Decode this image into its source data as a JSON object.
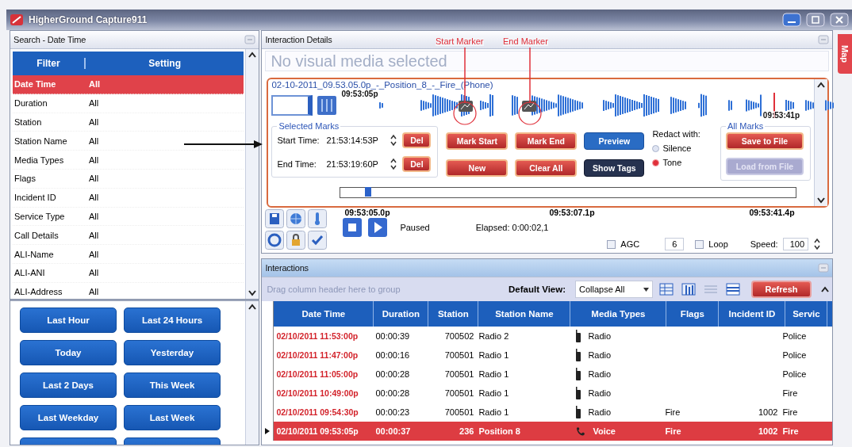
{
  "window": {
    "title": "HigherGround Capture911"
  },
  "search": {
    "title": "Search - Date Time",
    "columns": [
      "Filter",
      "Setting"
    ],
    "filters": [
      {
        "name": "Date Time",
        "setting": "All",
        "selected": true
      },
      {
        "name": "Duration",
        "setting": "All",
        "selected": false
      },
      {
        "name": "Station",
        "setting": "All",
        "selected": false
      },
      {
        "name": "Station Name",
        "setting": "All",
        "selected": false
      },
      {
        "name": "Media Types",
        "setting": "All",
        "selected": false
      },
      {
        "name": "Flags",
        "setting": "All",
        "selected": false
      },
      {
        "name": "Incident ID",
        "setting": "All",
        "selected": false
      },
      {
        "name": "Service Type",
        "setting": "All",
        "selected": false
      },
      {
        "name": "Call Details",
        "setting": "All",
        "selected": false
      },
      {
        "name": "ALI-Name",
        "setting": "All",
        "selected": false
      },
      {
        "name": "ALI-ANI",
        "setting": "All",
        "selected": false
      },
      {
        "name": "ALI-Address",
        "setting": "All",
        "selected": false
      }
    ],
    "quick_buttons": [
      "Last Hour",
      "Last 24 Hours",
      "Today",
      "Yesterday",
      "Last 2 Days",
      "This Week",
      "Last Weekday",
      "Last Week"
    ]
  },
  "annotations": [
    "Start Marker",
    "End Marker"
  ],
  "details": {
    "title": "Interaction Details",
    "visual_placeholder": "No visual media selected",
    "recording_title": "02-10-2011_09.53.05.0p_-_Position_8_-_Fire_(Phone)",
    "wave_start": "09:53:05p",
    "wave_end": "09:53:41p",
    "marks": {
      "title": "Selected Marks",
      "rows": [
        {
          "label": "Start Time:",
          "value": "21:53:14:53P",
          "button": "Del"
        },
        {
          "label": "End Time:",
          "value": "21:53:19:60P",
          "button": "Del"
        }
      ]
    },
    "actions": [
      {
        "label": "Mark Start",
        "kind": "red"
      },
      {
        "label": "Mark End",
        "kind": "red"
      },
      {
        "label": "Preview",
        "kind": "blue"
      },
      {
        "label": "New",
        "kind": "red"
      },
      {
        "label": "Clear All",
        "kind": "red"
      },
      {
        "label": "Show Tags",
        "kind": "navy"
      }
    ],
    "redact": {
      "label": "Redact with:",
      "options": [
        {
          "label": "Silence",
          "selected": false
        },
        {
          "label": "Tone",
          "selected": true
        }
      ]
    },
    "all_marks": {
      "title": "All Marks",
      "buttons": [
        {
          "label": "Save to File",
          "disabled": false
        },
        {
          "label": "Load from File",
          "disabled": true
        }
      ]
    },
    "timeline": {
      "level": 0.06,
      "ticks": [
        "09:53:05.0p",
        "09:53:07.1p",
        "09:53:41.4p"
      ]
    },
    "playback": {
      "status": "Paused",
      "elapsed": "Elapsed: 0:00:02,1",
      "agc": {
        "label": "AGC",
        "checked": false
      },
      "gain": "6",
      "loop": {
        "label": "Loop",
        "checked": false
      },
      "speed_label": "Speed:",
      "speed": "100"
    }
  },
  "map_tab": "Map",
  "interactions": {
    "title": "Interactions",
    "group_hint": "Drag column header here to group",
    "view_label": "Default View:",
    "view": "Collapse All",
    "refresh": "Refresh",
    "columns": [
      "Date Time",
      "Duration",
      "Station",
      "Station Name",
      "Media Types",
      "Flags",
      "Incident ID",
      "Servic"
    ],
    "rows": [
      {
        "date_time": "02/10/2011 11:53:00p",
        "duration": "00:00:39",
        "station": "700502",
        "station_name": "Radio 2",
        "media_type": "Radio",
        "kind": "radio",
        "service_type": "Police",
        "selected": false
      },
      {
        "date_time": "02/10/2011 11:47:00p",
        "duration": "00:00:16",
        "station": "700501",
        "station_name": "Radio 1",
        "media_type": "Radio",
        "kind": "radio",
        "service_type": "Police",
        "selected": false
      },
      {
        "date_time": "02/10/2011 11:05:00p",
        "duration": "00:00:28",
        "station": "700501",
        "station_name": "Radio 1",
        "media_type": "Radio",
        "kind": "radio",
        "service_type": "Police",
        "selected": false
      },
      {
        "date_time": "02/10/2011 10:49:00p",
        "duration": "00:00:28",
        "station": "700501",
        "station_name": "Radio 1",
        "media_type": "Radio",
        "kind": "radio",
        "service_type": "Fire",
        "selected": false
      },
      {
        "date_time": "02/10/2011 09:54:30p",
        "duration": "00:00:23",
        "station": "700501",
        "station_name": "Radio 1",
        "media_type": "Radio",
        "kind": "radio",
        "flags": "Fire",
        "incident_id": "1002",
        "service_type": "Fire",
        "selected": false
      },
      {
        "date_time": "02/10/2011 09:53:05p",
        "duration": "00:00:37",
        "station": "236",
        "station_name": "Position 8",
        "media_type": "Voice",
        "kind": "phone",
        "flags": "Fire",
        "incident_id": "1002",
        "service_type": "Fire",
        "selected": true
      }
    ]
  }
}
